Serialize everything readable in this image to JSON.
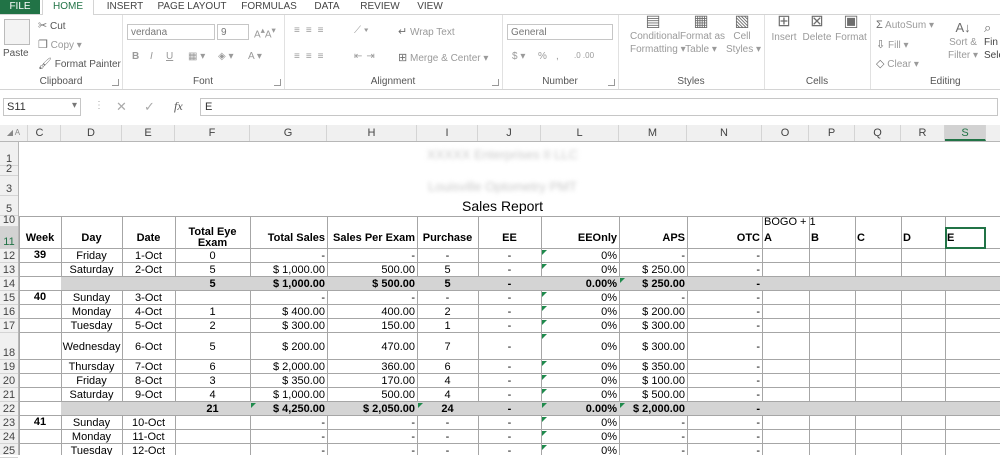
{
  "tabs": [
    "FILE",
    "HOME",
    "INSERT",
    "PAGE LAYOUT",
    "FORMULAS",
    "DATA",
    "REVIEW",
    "VIEW"
  ],
  "ribbon": {
    "clipboard": {
      "label": "Clipboard",
      "paste": "Paste",
      "cut": "Cut",
      "copy": "Copy",
      "format_painter": "Format Painter"
    },
    "font": {
      "label": "Font",
      "name": "verdana",
      "size": "9"
    },
    "alignment": {
      "label": "Alignment",
      "wrap": "Wrap Text",
      "merge": "Merge & Center"
    },
    "number": {
      "label": "Number",
      "format": "General"
    },
    "styles": {
      "label": "Styles",
      "conditional": "Conditional",
      "conditional2": "Formatting",
      "format_as": "Format as",
      "format_as2": "Table",
      "cell": "Cell",
      "cell2": "Styles"
    },
    "cells": {
      "label": "Cells",
      "insert": "Insert",
      "delete": "Delete",
      "format": "Format"
    },
    "editing": {
      "label": "Editing",
      "autosum": "AutoSum",
      "fill": "Fill",
      "clear": "Clear",
      "sort": "Sort &",
      "sort2": "Filter",
      "find": "Fin",
      "find2": "Sele"
    }
  },
  "formula_bar": {
    "name_box": "S11",
    "value": "E"
  },
  "columns": [
    "C",
    "D",
    "E",
    "F",
    "G",
    "H",
    "I",
    "J",
    "L",
    "M",
    "N",
    "O",
    "P",
    "Q",
    "R",
    "S"
  ],
  "report": {
    "company_line1": "XXXXX Enterprises II LLC",
    "company_line2": "Louisville Optometry PMT",
    "title": "Sales Report",
    "bogo": "BOGO + 1"
  },
  "headers": [
    "Week",
    "Day",
    "Date",
    "Total Eye Exam",
    "Total Sales",
    "Sales Per Exam",
    "Purchase",
    "EE",
    "EEOnly",
    "APS",
    "OTC",
    "A",
    "B",
    "C",
    "D",
    "E"
  ],
  "rows": [
    {
      "n": "12",
      "week": "39",
      "day": "Friday",
      "date": "1-Oct",
      "exams": "0",
      "sales": "-",
      "spe": "-",
      "purchase": "-",
      "ee": "-",
      "eeonly": "0%",
      "aps": "-",
      "otc": "-"
    },
    {
      "n": "13",
      "week": "",
      "day": "Saturday",
      "date": "2-Oct",
      "exams": "5",
      "sales": "$ 1,000.00",
      "spe": "500.00",
      "purchase": "5",
      "ee": "-",
      "eeonly": "0%",
      "aps": "$ 250.00",
      "otc": "-"
    },
    {
      "n": "14",
      "total": true,
      "exams": "5",
      "sales": "$ 1,000.00",
      "spe": "$ 500.00",
      "purchase": "5",
      "ee": "-",
      "eeonly": "0.00%",
      "aps": "$ 250.00",
      "otc": "-"
    },
    {
      "n": "15",
      "week": "40",
      "day": "Sunday",
      "date": "3-Oct",
      "exams": "",
      "sales": "-",
      "spe": "-",
      "purchase": "-",
      "ee": "-",
      "eeonly": "0%",
      "aps": "-",
      "otc": "-"
    },
    {
      "n": "16",
      "week": "",
      "day": "Monday",
      "date": "4-Oct",
      "exams": "1",
      "sales": "$ 400.00",
      "spe": "400.00",
      "purchase": "2",
      "ee": "-",
      "eeonly": "0%",
      "aps": "$ 200.00",
      "otc": "-"
    },
    {
      "n": "17",
      "week": "",
      "day": "Tuesday",
      "date": "5-Oct",
      "exams": "2",
      "sales": "$ 300.00",
      "spe": "150.00",
      "purchase": "1",
      "ee": "-",
      "eeonly": "0%",
      "aps": "$ 300.00",
      "otc": "-"
    },
    {
      "n": "18",
      "week": "",
      "day": "Wednesday",
      "date": "6-Oct",
      "exams": "5",
      "sales": "$ 200.00",
      "spe": "470.00",
      "purchase": "7",
      "ee": "-",
      "eeonly": "0%",
      "aps": "$ 300.00",
      "otc": "-"
    },
    {
      "n": "19",
      "week": "",
      "day": "Thursday",
      "date": "7-Oct",
      "exams": "6",
      "sales": "$ 2,000.00",
      "spe": "360.00",
      "purchase": "6",
      "ee": "-",
      "eeonly": "0%",
      "aps": "$ 350.00",
      "otc": "-"
    },
    {
      "n": "20",
      "week": "",
      "day": "Friday",
      "date": "8-Oct",
      "exams": "3",
      "sales": "$ 350.00",
      "spe": "170.00",
      "purchase": "4",
      "ee": "-",
      "eeonly": "0%",
      "aps": "$ 100.00",
      "otc": "-"
    },
    {
      "n": "21",
      "week": "",
      "day": "Saturday",
      "date": "9-Oct",
      "exams": "4",
      "sales": "$ 1,000.00",
      "spe": "500.00",
      "purchase": "4",
      "ee": "-",
      "eeonly": "0%",
      "aps": "$ 500.00",
      "otc": "-"
    },
    {
      "n": "22",
      "total": true,
      "exams": "21",
      "sales": "$ 4,250.00",
      "spe": "$ 2,050.00",
      "purchase": "24",
      "ee": "-",
      "eeonly": "0.00%",
      "aps": "$ 2,000.00",
      "otc": "-"
    },
    {
      "n": "23",
      "week": "41",
      "day": "Sunday",
      "date": "10-Oct",
      "exams": "",
      "sales": "-",
      "spe": "-",
      "purchase": "-",
      "ee": "-",
      "eeonly": "0%",
      "aps": "-",
      "otc": "-"
    },
    {
      "n": "24",
      "week": "",
      "day": "Monday",
      "date": "11-Oct",
      "exams": "",
      "sales": "-",
      "spe": "-",
      "purchase": "-",
      "ee": "-",
      "eeonly": "0%",
      "aps": "-",
      "otc": "-"
    },
    {
      "n": "25",
      "week": "",
      "day": "Tuesday",
      "date": "12-Oct",
      "exams": "",
      "sales": "-",
      "spe": "-",
      "purchase": "-",
      "ee": "-",
      "eeonly": "0%",
      "aps": "-",
      "otc": "-"
    }
  ],
  "row_numbers_top": [
    "1",
    "2",
    "3",
    "5",
    "10",
    "11"
  ],
  "partial_row": {
    "eeonly": "0.00%"
  }
}
